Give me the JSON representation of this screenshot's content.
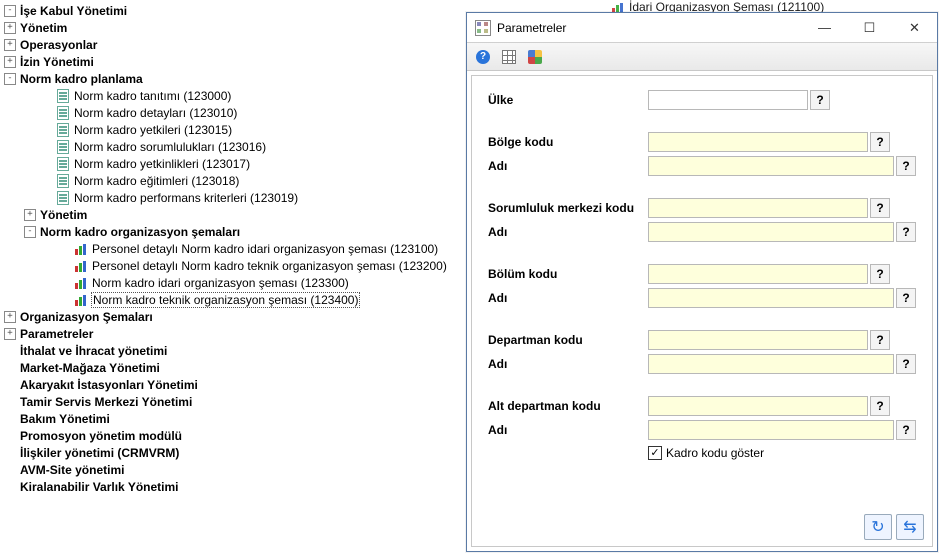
{
  "peek_node": "İdari Organizasyon Şeması (121100)",
  "tree": {
    "root_items": [
      {
        "expander": "-",
        "label": "İşe Kabul Yönetimi",
        "bold": true
      },
      {
        "expander": "+",
        "label": "Yönetim",
        "bold": true
      },
      {
        "expander": "+",
        "label": "Operasyonlar",
        "bold": true
      },
      {
        "expander": "+",
        "label": "İzin Yönetimi",
        "bold": true
      },
      {
        "expander": "-",
        "label": "Norm kadro planlama",
        "bold": true
      },
      {
        "expander": "+",
        "label": "Organizasyon Şemaları",
        "bold": true
      },
      {
        "expander": "+",
        "label": "Parametreler",
        "bold": true
      },
      {
        "expander": "",
        "label": "İthalat ve İhracat yönetimi",
        "bold": true
      },
      {
        "expander": "",
        "label": "Market-Mağaza Yönetimi",
        "bold": true
      },
      {
        "expander": "",
        "label": "Akaryakıt İstasyonları Yönetimi",
        "bold": true
      },
      {
        "expander": "",
        "label": "Tamir Servis Merkezi Yönetimi",
        "bold": true
      },
      {
        "expander": "",
        "label": "Bakım Yönetimi",
        "bold": true
      },
      {
        "expander": "",
        "label": "Promosyon yönetim modülü",
        "bold": true
      },
      {
        "expander": "",
        "label": "İlişkiler yönetimi (CRMVRM)",
        "bold": true
      },
      {
        "expander": "",
        "label": "AVM-Site yönetimi",
        "bold": true
      },
      {
        "expander": "",
        "label": "Kiralanabilir Varlık Yönetimi",
        "bold": true
      }
    ],
    "norm_children": [
      {
        "icon": "doc",
        "label": "Norm kadro tanıtımı (123000)"
      },
      {
        "icon": "doc",
        "label": "Norm kadro detayları (123010)"
      },
      {
        "icon": "doc",
        "label": "Norm kadro yetkileri (123015)"
      },
      {
        "icon": "doc",
        "label": "Norm kadro sorumlulukları (123016)"
      },
      {
        "icon": "doc",
        "label": "Norm kadro yetkinlikleri (123017)"
      },
      {
        "icon": "doc",
        "label": "Norm kadro eğitimleri (123018)"
      },
      {
        "icon": "doc",
        "label": "Norm kadro performans kriterleri (123019)"
      }
    ],
    "norm_sub": [
      {
        "expander": "+",
        "label": "Yönetim",
        "bold": true
      },
      {
        "expander": "-",
        "label": "Norm kadro organizasyon şemaları",
        "bold": true
      }
    ],
    "org_children": [
      {
        "icon": "chart",
        "label": "Personel detaylı Norm kadro idari organizasyon şeması (123100)"
      },
      {
        "icon": "chart",
        "label": "Personel detaylı Norm kadro teknik organizasyon şeması (123200)"
      },
      {
        "icon": "chart",
        "label": "Norm kadro idari organizasyon şeması (123300)"
      },
      {
        "icon": "chart",
        "label": "Norm kadro teknik organizasyon şeması (123400)",
        "selected": true
      }
    ]
  },
  "dialog": {
    "title": "Parametreler",
    "minimize_glyph": "—",
    "maximize_glyph": "☐",
    "close_glyph": "✕",
    "fields": {
      "country_label": "Ülke",
      "region_code_label": "Bölge kodu",
      "region_name_label": "Adı",
      "resp_code_label": "Sorumluluk merkezi kodu",
      "resp_name_label": "Adı",
      "section_code_label": "Bölüm kodu",
      "section_name_label": "Adı",
      "dept_code_label": "Departman kodu",
      "dept_name_label": "Adı",
      "subdept_code_label": "Alt departman kodu",
      "subdept_name_label": "Adı",
      "show_code_label": "Kadro kodu göster"
    },
    "values": {
      "country": "",
      "region_code": "",
      "region_name": "",
      "resp_code": "",
      "resp_name": "",
      "section_code": "",
      "section_name": "",
      "dept_code": "",
      "dept_name": "",
      "subdept_code": "",
      "subdept_name": "",
      "show_code_checked": true
    },
    "question_glyph": "?",
    "check_glyph": "✓",
    "btn_refresh_glyph": "↻",
    "btn_run_glyph": "⇆"
  }
}
